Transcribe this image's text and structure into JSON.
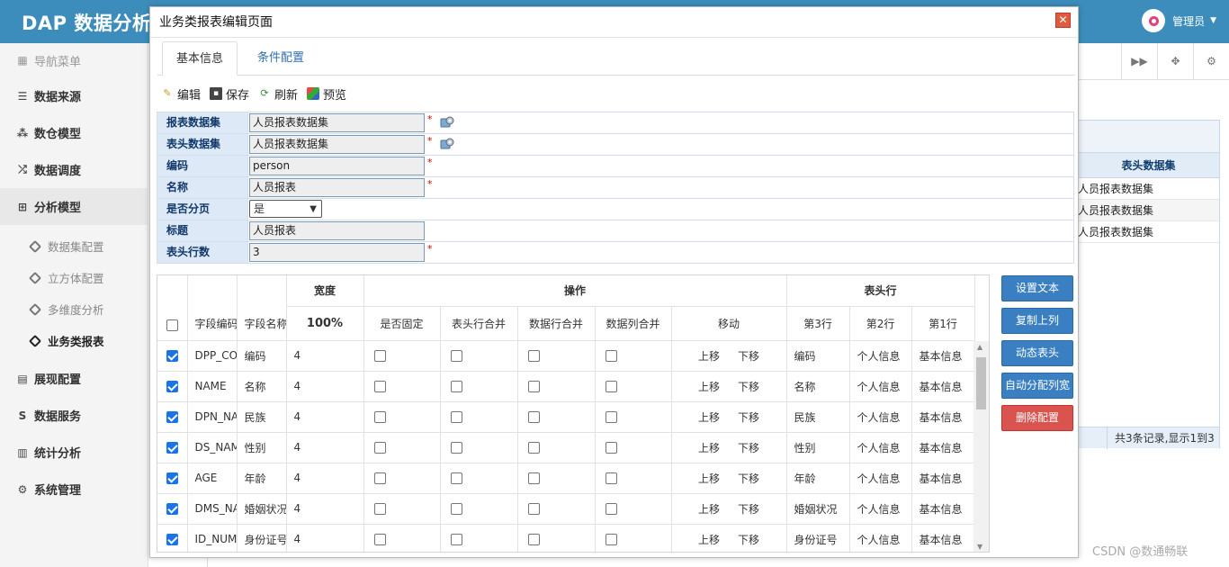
{
  "app": {
    "title": "DAP 数据分析",
    "user": "管理员"
  },
  "sidebar": {
    "header": "导航菜单",
    "items": [
      {
        "label": "数据来源",
        "icon": "database-icon"
      },
      {
        "label": "数仓模型",
        "icon": "cubes-icon"
      },
      {
        "label": "数据调度",
        "icon": "shuffle-icon"
      },
      {
        "label": "分析模型",
        "icon": "sitemap-icon"
      }
    ],
    "sub_items": [
      {
        "label": "数据集配置"
      },
      {
        "label": "立方体配置"
      },
      {
        "label": "多维度分析"
      },
      {
        "label": "业务类报表"
      }
    ],
    "items_after": [
      {
        "label": "展现配置",
        "icon": "film-icon"
      },
      {
        "label": "数据服务",
        "icon": "dollar-icon"
      },
      {
        "label": "统计分析",
        "icon": "bar-chart-icon"
      },
      {
        "label": "系统管理",
        "icon": "gear-icon"
      }
    ]
  },
  "background": {
    "column_header": "表头数据集",
    "rows": [
      "人员报表数据集",
      "人员报表数据集",
      "人员报表数据集"
    ],
    "pager_text": "共3条记录,显示1到3",
    "watermark": "CSDN @数通畅联"
  },
  "modal": {
    "title": "业务类报表编辑页面",
    "tabs": [
      "基本信息",
      "条件配置"
    ],
    "toolbar": {
      "edit": "编辑",
      "save": "保存",
      "refresh": "刷新",
      "preview": "预览"
    },
    "form": {
      "report_dataset": {
        "label": "报表数据集",
        "value": "人员报表数据集"
      },
      "header_dataset": {
        "label": "表头数据集",
        "value": "人员报表数据集"
      },
      "code": {
        "label": "编码",
        "value": "person"
      },
      "name": {
        "label": "名称",
        "value": "人员报表"
      },
      "paging": {
        "label": "是否分页",
        "value": "是"
      },
      "title": {
        "label": "标题",
        "value": "人员报表"
      },
      "header_rows": {
        "label": "表头行数",
        "value": "3"
      },
      "required_mark": "*"
    },
    "grid": {
      "headers": {
        "field_code": "字段编码",
        "field_name": "字段名称",
        "width": "宽度",
        "width_total": "100%",
        "operation": "操作",
        "fixed": "是否固定",
        "header_merge": "表头行合并",
        "data_row_merge": "数据行合并",
        "data_col_merge": "数据列合并",
        "move": "移动",
        "header_row": "表头行",
        "row3": "第3行",
        "row2": "第2行",
        "row1": "第1行"
      },
      "move_up": "上移",
      "move_down": "下移",
      "rows": [
        {
          "code": "DPP_CODE",
          "name": "编码",
          "width": "4",
          "r3": "编码",
          "r2": "个人信息",
          "r1": "基本信息"
        },
        {
          "code": "NAME",
          "name": "名称",
          "width": "4",
          "r3": "名称",
          "r2": "个人信息",
          "r1": "基本信息"
        },
        {
          "code": "DPN_NATION",
          "name": "民族",
          "width": "4",
          "r3": "民族",
          "r2": "个人信息",
          "r1": "基本信息"
        },
        {
          "code": "DS_NAME",
          "name": "性别",
          "width": "4",
          "r3": "性别",
          "r2": "个人信息",
          "r1": "基本信息"
        },
        {
          "code": "AGE",
          "name": "年龄",
          "width": "4",
          "r3": "年龄",
          "r2": "个人信息",
          "r1": "基本信息"
        },
        {
          "code": "DMS_NAME",
          "name": "婚姻状况",
          "width": "4",
          "r3": "婚姻状况",
          "r2": "个人信息",
          "r1": "基本信息"
        },
        {
          "code": "ID_NUMBER",
          "name": "身份证号",
          "width": "4",
          "r3": "身份证号",
          "r2": "个人信息",
          "r1": "基本信息"
        }
      ]
    },
    "side_buttons": [
      "设置文本",
      "复制上列",
      "动态表头",
      "自动分配列宽",
      "删除配置"
    ]
  }
}
